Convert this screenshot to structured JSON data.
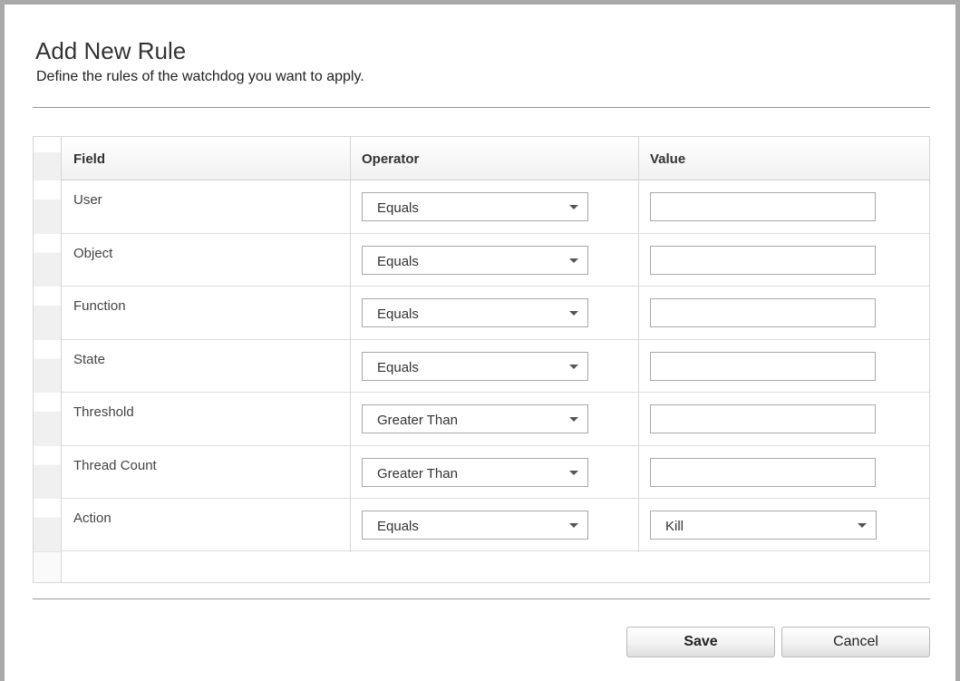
{
  "dialog": {
    "title": "Add New Rule",
    "subtitle": "Define the rules of the watchdog you want to apply."
  },
  "grid": {
    "columns": [
      "Field",
      "Operator",
      "Value"
    ],
    "rows": [
      {
        "field": "User",
        "operator": "Equals",
        "value": ""
      },
      {
        "field": "Object",
        "operator": "Equals",
        "value": ""
      },
      {
        "field": "Function",
        "operator": "Equals",
        "value": ""
      },
      {
        "field": "State",
        "operator": "Equals",
        "value": ""
      },
      {
        "field": "Threshold",
        "operator": "Greater Than",
        "value": ""
      },
      {
        "field": "Thread Count",
        "operator": "Greater Than",
        "value": ""
      },
      {
        "field": "Action",
        "operator": "Equals",
        "value": "Kill"
      }
    ]
  },
  "buttons": {
    "save_label": "Save",
    "cancel_label": "Cancel"
  },
  "colors": {
    "border": "#a9a9a9",
    "grid_line": "#d6d6d6",
    "text": "#333333"
  }
}
